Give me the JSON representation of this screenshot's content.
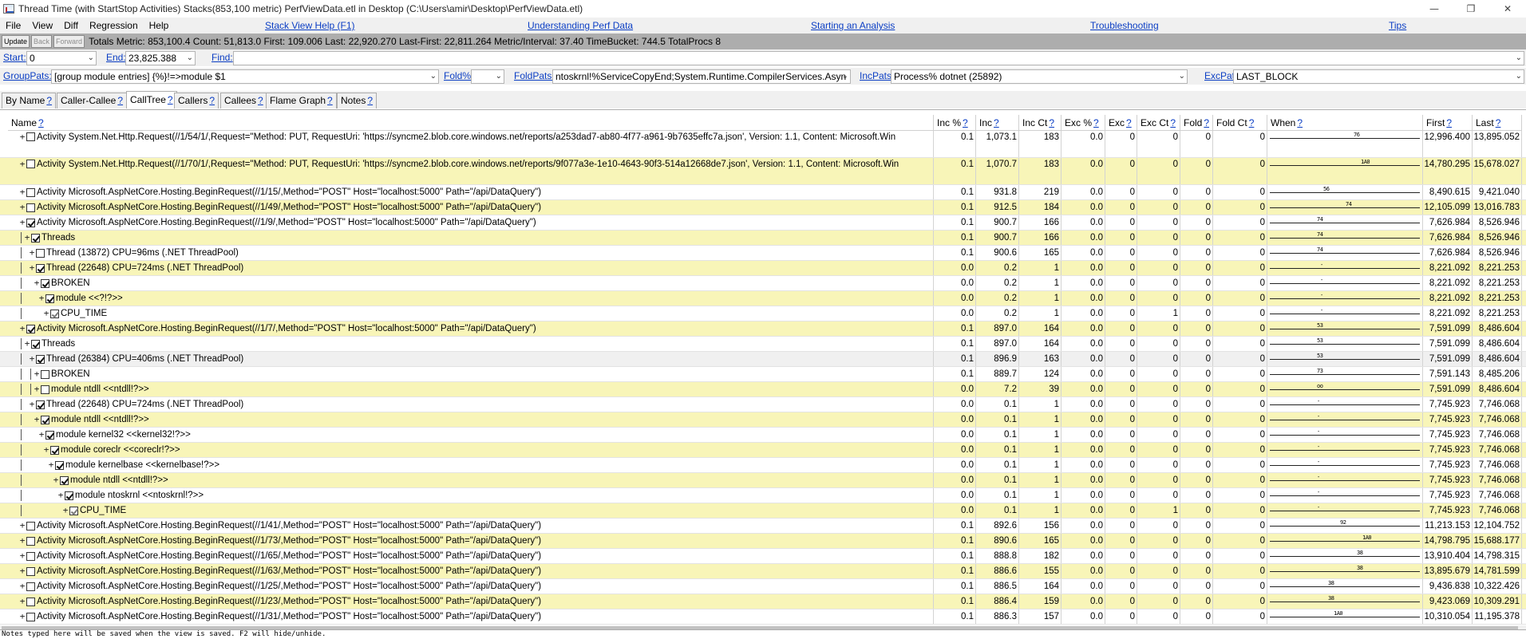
{
  "window": {
    "title": "Thread Time (with StartStop Activities) Stacks(853,100 metric) PerfViewData.etl in Desktop (C:\\Users\\amir\\Desktop\\PerfViewData.etl)",
    "minimize_glyph": "—",
    "restore_glyph": "❐",
    "close_glyph": "✕"
  },
  "menu": {
    "items": [
      "File",
      "View",
      "Diff",
      "Regression",
      "Help"
    ],
    "links": [
      "Stack View Help (F1)",
      "Understanding Perf Data",
      "Starting an Analysis",
      "Troubleshooting",
      "Tips"
    ]
  },
  "toolbar": {
    "update": "Update",
    "back": "Back",
    "forward": "Forward",
    "metrics": "Totals Metric: 853,100.4  Count: 51,813.0  First: 109.006  Last: 22,920.270  Last-First: 22,811.264  Metric/Interval: 37.40  TimeBucket: 744.5  TotalProcs 8"
  },
  "range": {
    "start_label": "Start:",
    "start_value": "0",
    "end_label": "End:",
    "end_value": "23,825.388",
    "find_label": "Find:",
    "find_value": ""
  },
  "filters": {
    "grouppats_label": "GroupPats:",
    "grouppats_value": "[group module entries]  {%}!=>module $1",
    "foldpct_label": "Fold%:",
    "foldpct_value": "",
    "foldpats_label": "FoldPats:",
    "foldpats_value": "ntoskrnl!%ServiceCopyEnd;System.Runtime.CompilerServices.Asyn",
    "incpats_label": "IncPats:",
    "incpats_value": "Process% dotnet (25892)",
    "excpats_label": "ExcPats:",
    "excpats_value": "LAST_BLOCK"
  },
  "tabs": [
    "By Name",
    "Caller-Callee",
    "CallTree",
    "Callers",
    "Callees",
    "Flame Graph",
    "Notes"
  ],
  "help_mark": "?",
  "columns": [
    "Name",
    "Inc %",
    "Inc",
    "Inc Ct",
    "Exc %",
    "Exc",
    "Exc Ct",
    "Fold",
    "Fold Ct",
    "When",
    "First",
    "Last"
  ],
  "rows": [
    {
      "guides": "",
      "exp": "+",
      "chk": false,
      "name": "Activity System.Net.Http.Request(//1/54/1/,Request=\"Method: PUT, RequestUri: 'https://syncme2.blob.core.windows.net/reports/a253dad7-ab80-4f77-a961-9b7635effc7a.json', Version: 1.1, Content: Microsoft.Win",
      "incp": "0.1",
      "inc": "1,073.1",
      "incct": "183",
      "excp": "0.0",
      "exc": "0",
      "excct": "0",
      "fold": "0",
      "foldct": "0",
      "when": "76",
      "whenpos": 0.57,
      "first": "12,996.400",
      "last": "13,895.052",
      "tall": true
    },
    {
      "guides": "",
      "exp": "+",
      "chk": false,
      "name": "Activity System.Net.Http.Request(//1/70/1/,Request=\"Method: PUT, RequestUri: 'https://syncme2.blob.core.windows.net/reports/9f077a3e-1e10-4643-90f3-514a12668de7.json', Version: 1.1, Content: Microsoft.Win",
      "incp": "0.1",
      "inc": "1,070.7",
      "incct": "183",
      "excp": "0.0",
      "exc": "0",
      "excct": "0",
      "fold": "0",
      "foldct": "0",
      "when": "1A0",
      "whenpos": 0.62,
      "first": "14,780.295",
      "last": "15,678.027",
      "tall": true
    },
    {
      "guides": "",
      "exp": "+",
      "chk": false,
      "name": "Activity Microsoft.AspNetCore.Hosting.BeginRequest(//1/15/,Method=\"POST\" Host=\"localhost:5000\" Path=\"/api/DataQuery\")",
      "incp": "0.1",
      "inc": "931.8",
      "incct": "219",
      "excp": "0.0",
      "exc": "0",
      "excct": "0",
      "fold": "0",
      "foldct": "0",
      "when": "56",
      "whenpos": 0.37,
      "first": "8,490.615",
      "last": "9,421.040"
    },
    {
      "guides": "",
      "exp": "+",
      "chk": false,
      "name": "Activity Microsoft.AspNetCore.Hosting.BeginRequest(//1/49/,Method=\"POST\" Host=\"localhost:5000\" Path=\"/api/DataQuery\")",
      "incp": "0.1",
      "inc": "912.5",
      "incct": "184",
      "excp": "0.0",
      "exc": "0",
      "excct": "0",
      "fold": "0",
      "foldct": "0",
      "when": "74",
      "whenpos": 0.52,
      "first": "12,105.099",
      "last": "13,016.783"
    },
    {
      "guides": "",
      "exp": "+",
      "chk": true,
      "name": "Activity Microsoft.AspNetCore.Hosting.BeginRequest(//1/9/,Method=\"POST\" Host=\"localhost:5000\" Path=\"/api/DataQuery\")",
      "incp": "0.1",
      "inc": "900.7",
      "incct": "166",
      "excp": "0.0",
      "exc": "0",
      "excct": "0",
      "fold": "0",
      "foldct": "0",
      "when": "74",
      "whenpos": 0.33,
      "first": "7,626.984",
      "last": "8,526.946"
    },
    {
      "guides": "v",
      "exp": "+",
      "chk": true,
      "name": "Threads",
      "incp": "0.1",
      "inc": "900.7",
      "incct": "166",
      "excp": "0.0",
      "exc": "0",
      "excct": "0",
      "fold": "0",
      "foldct": "0",
      "when": "74",
      "whenpos": 0.33,
      "first": "7,626.984",
      "last": "8,526.946"
    },
    {
      "guides": "v.",
      "exp": "+",
      "chk": false,
      "name": "Thread (13872) CPU=96ms (.NET ThreadPool)",
      "incp": "0.1",
      "inc": "900.6",
      "incct": "165",
      "excp": "0.0",
      "exc": "0",
      "excct": "0",
      "fold": "0",
      "foldct": "0",
      "when": "74",
      "whenpos": 0.33,
      "first": "7,626.984",
      "last": "8,526.946"
    },
    {
      "guides": "v.",
      "exp": "+",
      "chk": true,
      "name": "Thread (22648) CPU=724ms (.NET ThreadPool)",
      "incp": "0.0",
      "inc": "0.2",
      "incct": "1",
      "excp": "0.0",
      "exc": "0",
      "excct": "0",
      "fold": "0",
      "foldct": "0",
      "when": "-",
      "whenpos": 0.35,
      "first": "8,221.092",
      "last": "8,221.253"
    },
    {
      "guides": "v..",
      "exp": "+",
      "chk": true,
      "name": "BROKEN",
      "incp": "0.0",
      "inc": "0.2",
      "incct": "1",
      "excp": "0.0",
      "exc": "0",
      "excct": "0",
      "fold": "0",
      "foldct": "0",
      "when": "-",
      "whenpos": 0.35,
      "first": "8,221.092",
      "last": "8,221.253"
    },
    {
      "guides": "v...",
      "exp": "+",
      "chk": true,
      "name": "module  <<?!?>>",
      "incp": "0.0",
      "inc": "0.2",
      "incct": "1",
      "excp": "0.0",
      "exc": "0",
      "excct": "0",
      "fold": "0",
      "foldct": "0",
      "when": "-",
      "whenpos": 0.35,
      "first": "8,221.092",
      "last": "8,221.253"
    },
    {
      "guides": "v....",
      "exp": "+",
      "chk": true,
      "dim": true,
      "name": "CPU_TIME",
      "incp": "0.0",
      "inc": "0.2",
      "incct": "1",
      "excp": "0.0",
      "exc": "0",
      "excct": "1",
      "fold": "0",
      "foldct": "0",
      "when": "-",
      "whenpos": 0.35,
      "first": "8,221.092",
      "last": "8,221.253"
    },
    {
      "guides": "",
      "exp": "+",
      "chk": true,
      "name": "Activity Microsoft.AspNetCore.Hosting.BeginRequest(//1/7/,Method=\"POST\" Host=\"localhost:5000\" Path=\"/api/DataQuery\")",
      "incp": "0.1",
      "inc": "897.0",
      "incct": "164",
      "excp": "0.0",
      "exc": "0",
      "excct": "0",
      "fold": "0",
      "foldct": "0",
      "when": "53",
      "whenpos": 0.33,
      "first": "7,591.099",
      "last": "8,486.604"
    },
    {
      "guides": "v",
      "exp": "+",
      "chk": true,
      "name": "Threads",
      "incp": "0.1",
      "inc": "897.0",
      "incct": "164",
      "excp": "0.0",
      "exc": "0",
      "excct": "0",
      "fold": "0",
      "foldct": "0",
      "when": "53",
      "whenpos": 0.33,
      "first": "7,591.099",
      "last": "8,486.604"
    },
    {
      "guides": "v.",
      "exp": "+",
      "chk": true,
      "name": "Thread (26384) CPU=406ms (.NET ThreadPool)",
      "incp": "0.1",
      "inc": "896.9",
      "incct": "163",
      "excp": "0.0",
      "exc": "0",
      "excct": "0",
      "fold": "0",
      "foldct": "0",
      "when": "53",
      "whenpos": 0.33,
      "first": "7,591.099",
      "last": "8,486.604",
      "sel": true
    },
    {
      "guides": "v.v",
      "exp": "+",
      "chk": false,
      "name": "BROKEN",
      "incp": "0.1",
      "inc": "889.7",
      "incct": "124",
      "excp": "0.0",
      "exc": "0",
      "excct": "0",
      "fold": "0",
      "foldct": "0",
      "when": "73",
      "whenpos": 0.33,
      "first": "7,591.143",
      "last": "8,485.206"
    },
    {
      "guides": "v.v",
      "exp": "+",
      "chk": false,
      "name": "module ntdll <<ntdll!?>>",
      "incp": "0.0",
      "inc": "7.2",
      "incct": "39",
      "excp": "0.0",
      "exc": "0",
      "excct": "0",
      "fold": "0",
      "foldct": "0",
      "when": "oo",
      "whenpos": 0.33,
      "first": "7,591.099",
      "last": "8,486.604"
    },
    {
      "guides": "v.",
      "exp": "+",
      "chk": true,
      "name": "Thread (22648) CPU=724ms (.NET ThreadPool)",
      "incp": "0.0",
      "inc": "0.1",
      "incct": "1",
      "excp": "0.0",
      "exc": "0",
      "excct": "0",
      "fold": "0",
      "foldct": "0",
      "when": "-",
      "whenpos": 0.33,
      "first": "7,745.923",
      "last": "7,746.068"
    },
    {
      "guides": "v..",
      "exp": "+",
      "chk": true,
      "name": "module ntdll <<ntdll!?>>",
      "incp": "0.0",
      "inc": "0.1",
      "incct": "1",
      "excp": "0.0",
      "exc": "0",
      "excct": "0",
      "fold": "0",
      "foldct": "0",
      "when": "-",
      "whenpos": 0.33,
      "first": "7,745.923",
      "last": "7,746.068"
    },
    {
      "guides": "v...",
      "exp": "+",
      "chk": true,
      "name": "module kernel32 <<kernel32!?>>",
      "incp": "0.0",
      "inc": "0.1",
      "incct": "1",
      "excp": "0.0",
      "exc": "0",
      "excct": "0",
      "fold": "0",
      "foldct": "0",
      "when": "-",
      "whenpos": 0.33,
      "first": "7,745.923",
      "last": "7,746.068"
    },
    {
      "guides": "v....",
      "exp": "+",
      "chk": true,
      "name": "module coreclr <<coreclr!?>>",
      "incp": "0.0",
      "inc": "0.1",
      "incct": "1",
      "excp": "0.0",
      "exc": "0",
      "excct": "0",
      "fold": "0",
      "foldct": "0",
      "when": "-",
      "whenpos": 0.33,
      "first": "7,745.923",
      "last": "7,746.068"
    },
    {
      "guides": "v.....",
      "exp": "+",
      "chk": true,
      "name": "module kernelbase <<kernelbase!?>>",
      "incp": "0.0",
      "inc": "0.1",
      "incct": "1",
      "excp": "0.0",
      "exc": "0",
      "excct": "0",
      "fold": "0",
      "foldct": "0",
      "when": "-",
      "whenpos": 0.33,
      "first": "7,745.923",
      "last": "7,746.068"
    },
    {
      "guides": "v......",
      "exp": "+",
      "chk": true,
      "name": "module ntdll <<ntdll!?>>",
      "incp": "0.0",
      "inc": "0.1",
      "incct": "1",
      "excp": "0.0",
      "exc": "0",
      "excct": "0",
      "fold": "0",
      "foldct": "0",
      "when": "-",
      "whenpos": 0.33,
      "first": "7,745.923",
      "last": "7,746.068"
    },
    {
      "guides": "v.......",
      "exp": "+",
      "chk": true,
      "name": "module ntoskrnl <<ntoskrnl!?>>",
      "incp": "0.0",
      "inc": "0.1",
      "incct": "1",
      "excp": "0.0",
      "exc": "0",
      "excct": "0",
      "fold": "0",
      "foldct": "0",
      "when": "-",
      "whenpos": 0.33,
      "first": "7,745.923",
      "last": "7,746.068"
    },
    {
      "guides": "v........",
      "exp": "+",
      "chk": true,
      "dim": true,
      "name": "CPU_TIME",
      "incp": "0.0",
      "inc": "0.1",
      "incct": "1",
      "excp": "0.0",
      "exc": "0",
      "excct": "1",
      "fold": "0",
      "foldct": "0",
      "when": "-",
      "whenpos": 0.33,
      "first": "7,745.923",
      "last": "7,746.068"
    },
    {
      "guides": "",
      "exp": "+",
      "chk": false,
      "name": "Activity Microsoft.AspNetCore.Hosting.BeginRequest(//1/41/,Method=\"POST\" Host=\"localhost:5000\" Path=\"/api/DataQuery\")",
      "incp": "0.1",
      "inc": "892.6",
      "incct": "156",
      "excp": "0.0",
      "exc": "0",
      "excct": "0",
      "fold": "0",
      "foldct": "0",
      "when": "92",
      "whenpos": 0.48,
      "first": "11,213.153",
      "last": "12,104.752"
    },
    {
      "guides": "",
      "exp": "+",
      "chk": false,
      "name": "Activity Microsoft.AspNetCore.Hosting.BeginRequest(//1/73/,Method=\"POST\" Host=\"localhost:5000\" Path=\"/api/DataQuery\")",
      "incp": "0.1",
      "inc": "890.6",
      "incct": "165",
      "excp": "0.0",
      "exc": "0",
      "excct": "0",
      "fold": "0",
      "foldct": "0",
      "when": "1A0",
      "whenpos": 0.63,
      "first": "14,798.795",
      "last": "15,688.177"
    },
    {
      "guides": "",
      "exp": "+",
      "chk": false,
      "name": "Activity Microsoft.AspNetCore.Hosting.BeginRequest(//1/65/,Method=\"POST\" Host=\"localhost:5000\" Path=\"/api/DataQuery\")",
      "incp": "0.1",
      "inc": "888.8",
      "incct": "182",
      "excp": "0.0",
      "exc": "0",
      "excct": "0",
      "fold": "0",
      "foldct": "0",
      "when": "38",
      "whenpos": 0.59,
      "first": "13,910.404",
      "last": "14,798.315"
    },
    {
      "guides": "",
      "exp": "+",
      "chk": false,
      "name": "Activity Microsoft.AspNetCore.Hosting.BeginRequest(//1/63/,Method=\"POST\" Host=\"localhost:5000\" Path=\"/api/DataQuery\")",
      "incp": "0.1",
      "inc": "886.6",
      "incct": "155",
      "excp": "0.0",
      "exc": "0",
      "excct": "0",
      "fold": "0",
      "foldct": "0",
      "when": "38",
      "whenpos": 0.59,
      "first": "13,895.679",
      "last": "14,781.599"
    },
    {
      "guides": "",
      "exp": "+",
      "chk": false,
      "name": "Activity Microsoft.AspNetCore.Hosting.BeginRequest(//1/25/,Method=\"POST\" Host=\"localhost:5000\" Path=\"/api/DataQuery\")",
      "incp": "0.1",
      "inc": "886.5",
      "incct": "164",
      "excp": "0.0",
      "exc": "0",
      "excct": "0",
      "fold": "0",
      "foldct": "0",
      "when": "38",
      "whenpos": 0.4,
      "first": "9,436.838",
      "last": "10,322.426"
    },
    {
      "guides": "",
      "exp": "+",
      "chk": false,
      "name": "Activity Microsoft.AspNetCore.Hosting.BeginRequest(//1/23/,Method=\"POST\" Host=\"localhost:5000\" Path=\"/api/DataQuery\")",
      "incp": "0.1",
      "inc": "886.4",
      "incct": "159",
      "excp": "0.0",
      "exc": "0",
      "excct": "0",
      "fold": "0",
      "foldct": "0",
      "when": "38",
      "whenpos": 0.4,
      "first": "9,423.069",
      "last": "10,309.291"
    },
    {
      "guides": "",
      "exp": "+",
      "chk": false,
      "name": "Activity Microsoft.AspNetCore.Hosting.BeginRequest(//1/31/,Method=\"POST\" Host=\"localhost:5000\" Path=\"/api/DataQuery\")",
      "incp": "0.1",
      "inc": "886.3",
      "incct": "157",
      "excp": "0.0",
      "exc": "0",
      "excct": "0",
      "fold": "0",
      "foldct": "0",
      "when": "1A0",
      "whenpos": 0.44,
      "first": "10,310.054",
      "last": "11,195.378"
    }
  ],
  "notes": "Notes typed here will be saved when the view is saved. F2 will hide/unhide."
}
